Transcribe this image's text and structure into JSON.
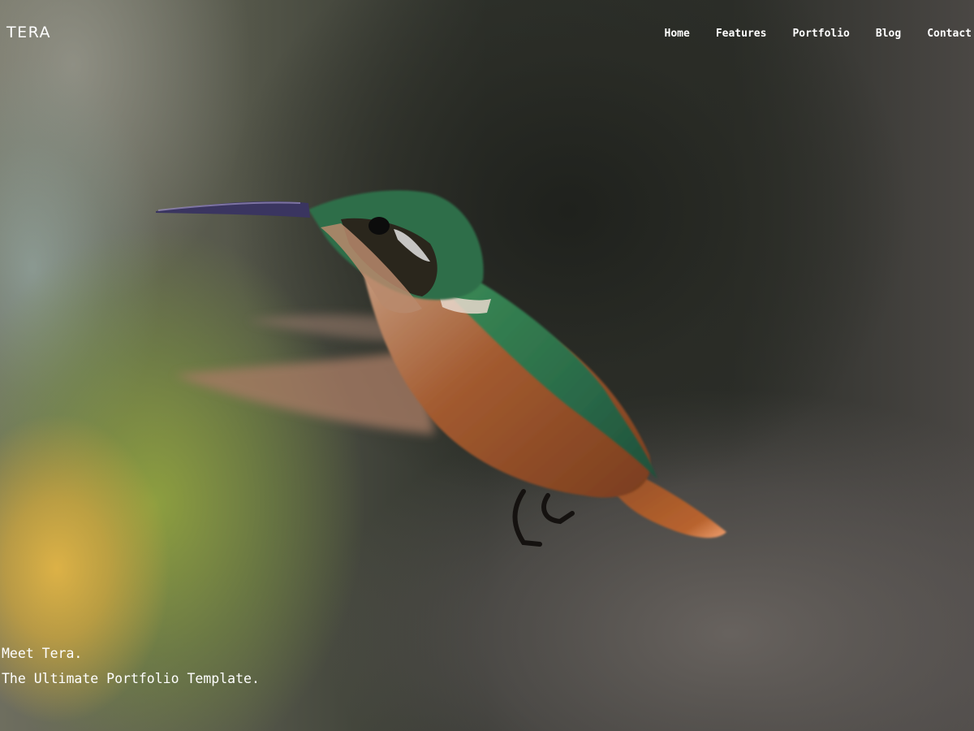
{
  "brand": {
    "name": "TERA"
  },
  "nav": {
    "items": [
      {
        "label": "Home"
      },
      {
        "label": "Features"
      },
      {
        "label": "Portfolio"
      },
      {
        "label": "Blog"
      },
      {
        "label": "Contact"
      }
    ]
  },
  "hero": {
    "line1": "Meet Tera.",
    "line2": "The Ultimate Portfolio Template."
  },
  "colors": {
    "text": "#ffffff",
    "background_dark": "#2c2e29",
    "bird_green": "#2f7d4e",
    "bird_rust": "#a2552a"
  }
}
